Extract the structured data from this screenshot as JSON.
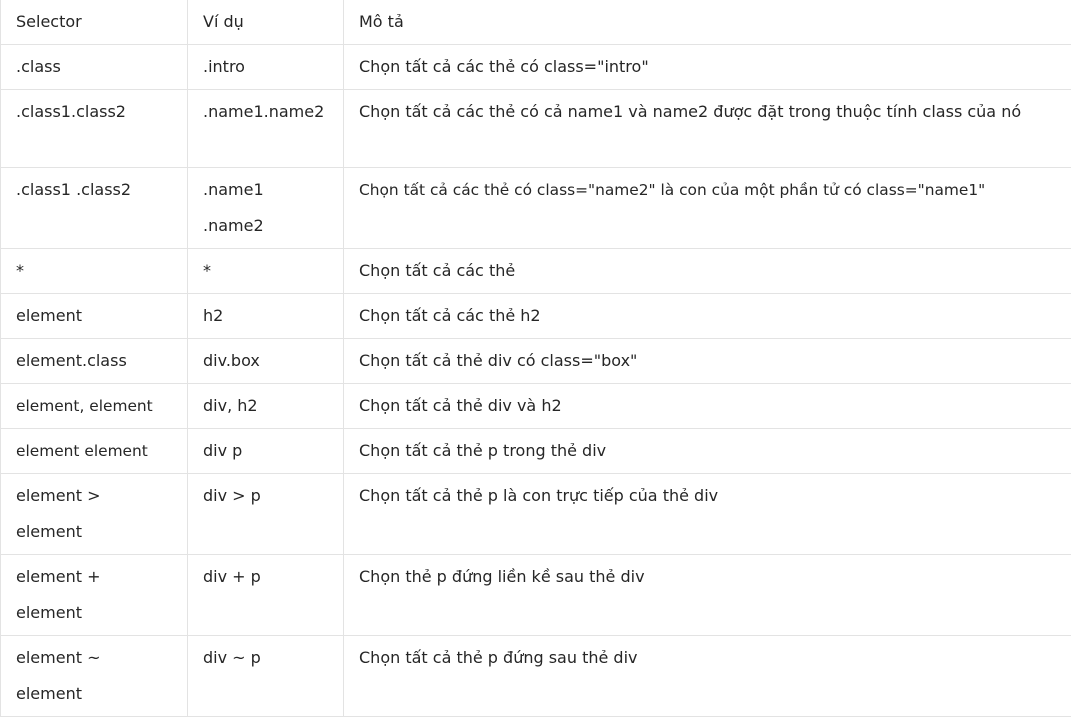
{
  "table": {
    "headers": [
      "Selector",
      "Ví dụ",
      "Mô tả"
    ],
    "rows": [
      {
        "selector": ".class",
        "example": ".intro",
        "description": "Chọn tất cả các thẻ có class=\"intro\""
      },
      {
        "selector": ".class1.class2",
        "example": ".name1.name2",
        "description": "Chọn tất cả các thẻ có cả name1 và name2 được đặt trong thuộc tính class của nó"
      },
      {
        "selector": ".class1 .class2",
        "example": ".name1 .name2",
        "description": "Chọn tất cả các thẻ có class=\"name2\" là con của một phần tử có class=\"name1\""
      },
      {
        "selector": "*",
        "example": "*",
        "description": "Chọn tất cả các thẻ"
      },
      {
        "selector": "element",
        "example": "h2",
        "description": "Chọn tất cả các thẻ h2"
      },
      {
        "selector": "element.class",
        "example": "div.box",
        "description": "Chọn tất cả thẻ div có class=\"box\""
      },
      {
        "selector": "element, element",
        "example": "div, h2",
        "description": "Chọn tất cả thẻ div và h2"
      },
      {
        "selector": "element element",
        "example": "div p",
        "description": "Chọn tất cả thẻ p trong thẻ div"
      },
      {
        "selector": "element > element",
        "example": "div > p",
        "description": "Chọn tất cả thẻ p là con trực tiếp của thẻ div"
      },
      {
        "selector": "element + element",
        "example": "div + p",
        "description": "Chọn thẻ p đứng liền kề sau thẻ div"
      },
      {
        "selector": "element ~ element",
        "example": "div ~ p",
        "description": "Chọn tất cả thẻ p đứng sau thẻ div"
      }
    ]
  }
}
